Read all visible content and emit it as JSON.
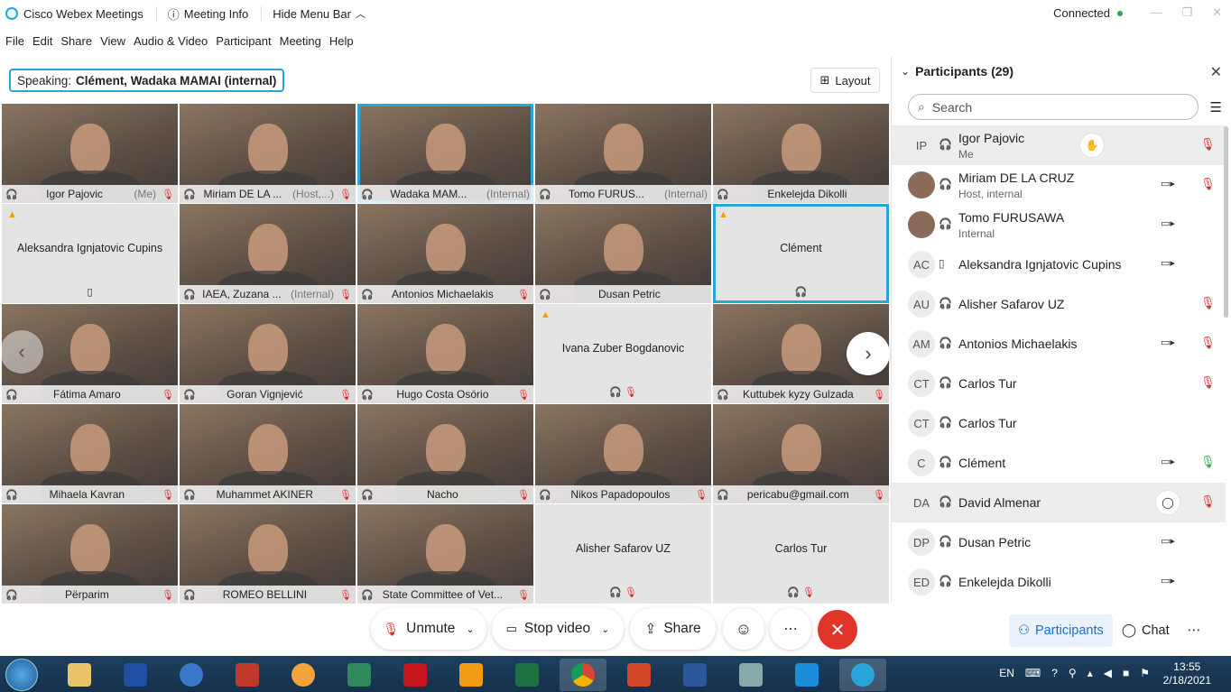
{
  "titlebar": {
    "app": "Cisco Webex Meetings",
    "meeting_info": "Meeting Info",
    "hide_menu": "Hide Menu Bar",
    "status": "Connected"
  },
  "menu": [
    "File",
    "Edit",
    "Share",
    "View",
    "Audio & Video",
    "Participant",
    "Meeting",
    "Help"
  ],
  "speaking": {
    "label": "Speaking:",
    "names": "Clément, Wadaka MAMAI (internal)"
  },
  "layout_label": "Layout",
  "tiles": [
    {
      "name": "Igor Pajovic",
      "tag": "(Me)",
      "video": true,
      "muted": true
    },
    {
      "name": "Miriam DE LA ...",
      "tag": "(Host,...)",
      "video": true,
      "muted": true
    },
    {
      "name": "Wadaka MAM...",
      "tag": "(Internal)",
      "video": true,
      "muted": false,
      "highlight": true
    },
    {
      "name": "Tomo FURUS...",
      "tag": "(Internal)",
      "video": true,
      "muted": false
    },
    {
      "name": "Enkelejda Dikolli",
      "tag": "",
      "video": true,
      "muted": false
    },
    {
      "name": "Aleksandra Ignjatovic Cupins",
      "tag": "",
      "video": false,
      "muted": false,
      "warn": true,
      "phone": true
    },
    {
      "name": "IAEA, Zuzana ...",
      "tag": "(Internal)",
      "video": true,
      "muted": true
    },
    {
      "name": "Antonios Michaelakis",
      "tag": "",
      "video": true,
      "muted": true
    },
    {
      "name": "Dusan Petric",
      "tag": "",
      "video": true,
      "muted": false
    },
    {
      "name": "Clément",
      "tag": "",
      "video": false,
      "muted": false,
      "warn": true,
      "highlight": true
    },
    {
      "name": "Fátima Amaro",
      "tag": "",
      "video": true,
      "muted": true
    },
    {
      "name": "Goran Vignjević",
      "tag": "",
      "video": true,
      "muted": true
    },
    {
      "name": "Hugo Costa Osório",
      "tag": "",
      "video": true,
      "muted": true
    },
    {
      "name": "Ivana Zuber Bogdanovic",
      "tag": "",
      "video": false,
      "muted": true,
      "warn": true
    },
    {
      "name": "Kuttubek kyzy Gulzada",
      "tag": "",
      "video": true,
      "muted": true
    },
    {
      "name": "Mihaela Kavran",
      "tag": "",
      "video": true,
      "muted": true
    },
    {
      "name": "Muhammet AKINER",
      "tag": "",
      "video": true,
      "muted": true
    },
    {
      "name": "Nacho",
      "tag": "",
      "video": true,
      "muted": true
    },
    {
      "name": "Nikos Papadopoulos",
      "tag": "",
      "video": true,
      "muted": true
    },
    {
      "name": "pericabu@gmail.com",
      "tag": "",
      "video": true,
      "muted": true
    },
    {
      "name": "Përparim",
      "tag": "",
      "video": true,
      "muted": true
    },
    {
      "name": "ROMEO BELLINI",
      "tag": "",
      "video": true,
      "muted": true
    },
    {
      "name": "State Committee of Vet...",
      "tag": "",
      "video": true,
      "muted": true
    },
    {
      "name": "Alisher Safarov UZ",
      "tag": "",
      "video": false,
      "muted": true
    },
    {
      "name": "Carlos Tur",
      "tag": "",
      "video": false,
      "muted": true
    }
  ],
  "controls": {
    "unmute": "Unmute",
    "stop_video": "Stop video",
    "share": "Share"
  },
  "panel": {
    "title": "Participants (29)",
    "search_placeholder": "Search",
    "participants": [
      {
        "initials": "IP",
        "name": "Igor Pajovic",
        "sub": "Me",
        "cam": false,
        "mic": "muted",
        "raise": true,
        "selected": true
      },
      {
        "initials": "",
        "name": "Miriam DE LA CRUZ",
        "sub": "Host, internal",
        "cam": true,
        "mic": "muted",
        "photo": true
      },
      {
        "initials": "",
        "name": "Tomo FURUSAWA",
        "sub": "Internal",
        "cam": true,
        "mic": "",
        "photo": true
      },
      {
        "initials": "AC",
        "name": "Aleksandra Ignjatovic Cupins",
        "sub": "",
        "cam": true,
        "mic": "",
        "phone": true
      },
      {
        "initials": "AU",
        "name": "Alisher Safarov UZ",
        "sub": "",
        "cam": false,
        "mic": "muted"
      },
      {
        "initials": "AM",
        "name": "Antonios Michaelakis",
        "sub": "",
        "cam": true,
        "mic": "muted"
      },
      {
        "initials": "CT",
        "name": "Carlos Tur",
        "sub": "",
        "cam": false,
        "mic": "muted"
      },
      {
        "initials": "CT",
        "name": "Carlos Tur",
        "sub": "",
        "cam": false,
        "mic": ""
      },
      {
        "initials": "C",
        "name": "Clément",
        "sub": "",
        "cam": true,
        "mic": "active"
      },
      {
        "initials": "DA",
        "name": "David Almenar",
        "sub": "",
        "cam": false,
        "mic": "muted",
        "chat": true,
        "selected": true
      },
      {
        "initials": "DP",
        "name": "Dusan Petric",
        "sub": "",
        "cam": true,
        "mic": ""
      },
      {
        "initials": "ED",
        "name": "Enkelejda Dikolli",
        "sub": "",
        "cam": true,
        "mic": ""
      }
    ]
  },
  "bottom_tabs": {
    "participants": "Participants",
    "chat": "Chat"
  },
  "taskbar": {
    "lang": "EN",
    "time": "13:55",
    "date": "2/18/2021"
  }
}
